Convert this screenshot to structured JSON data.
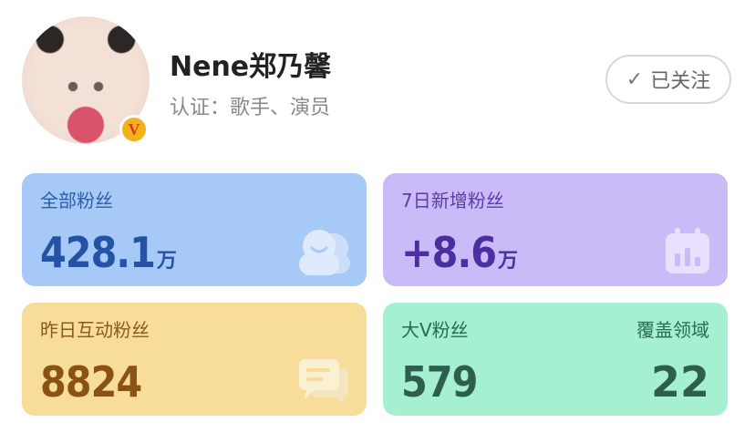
{
  "profile": {
    "name": "Nene郑乃馨",
    "certification": "认证：歌手、演员",
    "verified_badge": "V",
    "avatar_icon": "avatar-photo"
  },
  "follow_button": {
    "label": "已关注",
    "icon": "check-icon"
  },
  "stats": {
    "total_fans": {
      "label": "全部粉丝",
      "value": "428.1",
      "unit": "万",
      "icon": "fans-icon",
      "color": "#a6c9f7"
    },
    "new_fans_7d": {
      "label": "7日新增粉丝",
      "value": "+8.6",
      "unit": "万",
      "icon": "calendar-chart-icon",
      "color": "#cbbaf8"
    },
    "interactive_fans_yesterday": {
      "label": "昨日互动粉丝",
      "value": "8824",
      "icon": "message-icon",
      "color": "#f7dc9a"
    },
    "bigv_fans": {
      "label": "大V粉丝",
      "value": "579",
      "color": "#a6f0d2"
    },
    "coverage_fields": {
      "label": "覆盖领域",
      "value": "22"
    }
  }
}
